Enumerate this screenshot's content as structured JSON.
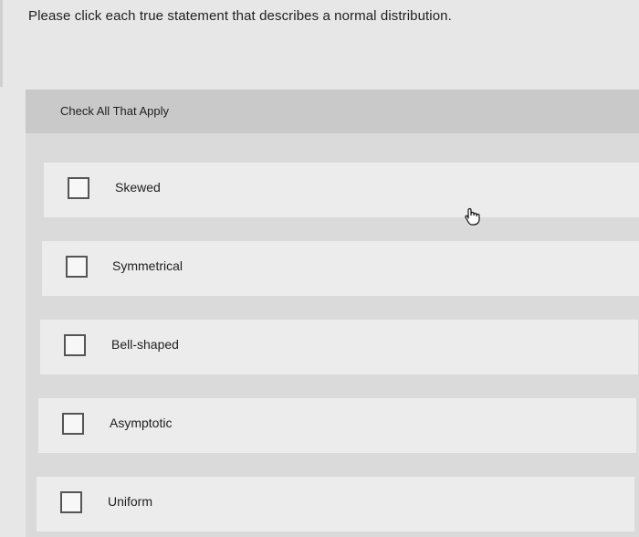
{
  "question": "Please click each true statement that describes a normal distribution.",
  "panel": {
    "header": "Check All That Apply",
    "options": [
      {
        "label": "Skewed",
        "checked": false
      },
      {
        "label": "Symmetrical",
        "checked": false
      },
      {
        "label": "Bell-shaped",
        "checked": false
      },
      {
        "label": "Asymptotic",
        "checked": false
      },
      {
        "label": "Uniform",
        "checked": false
      }
    ]
  },
  "cursor_icon": "hand-pointer-icon",
  "colors": {
    "background": "#e7e7e7",
    "header": "#c9c9c9",
    "option": "#ececec",
    "checkbox_border": "#555555"
  }
}
